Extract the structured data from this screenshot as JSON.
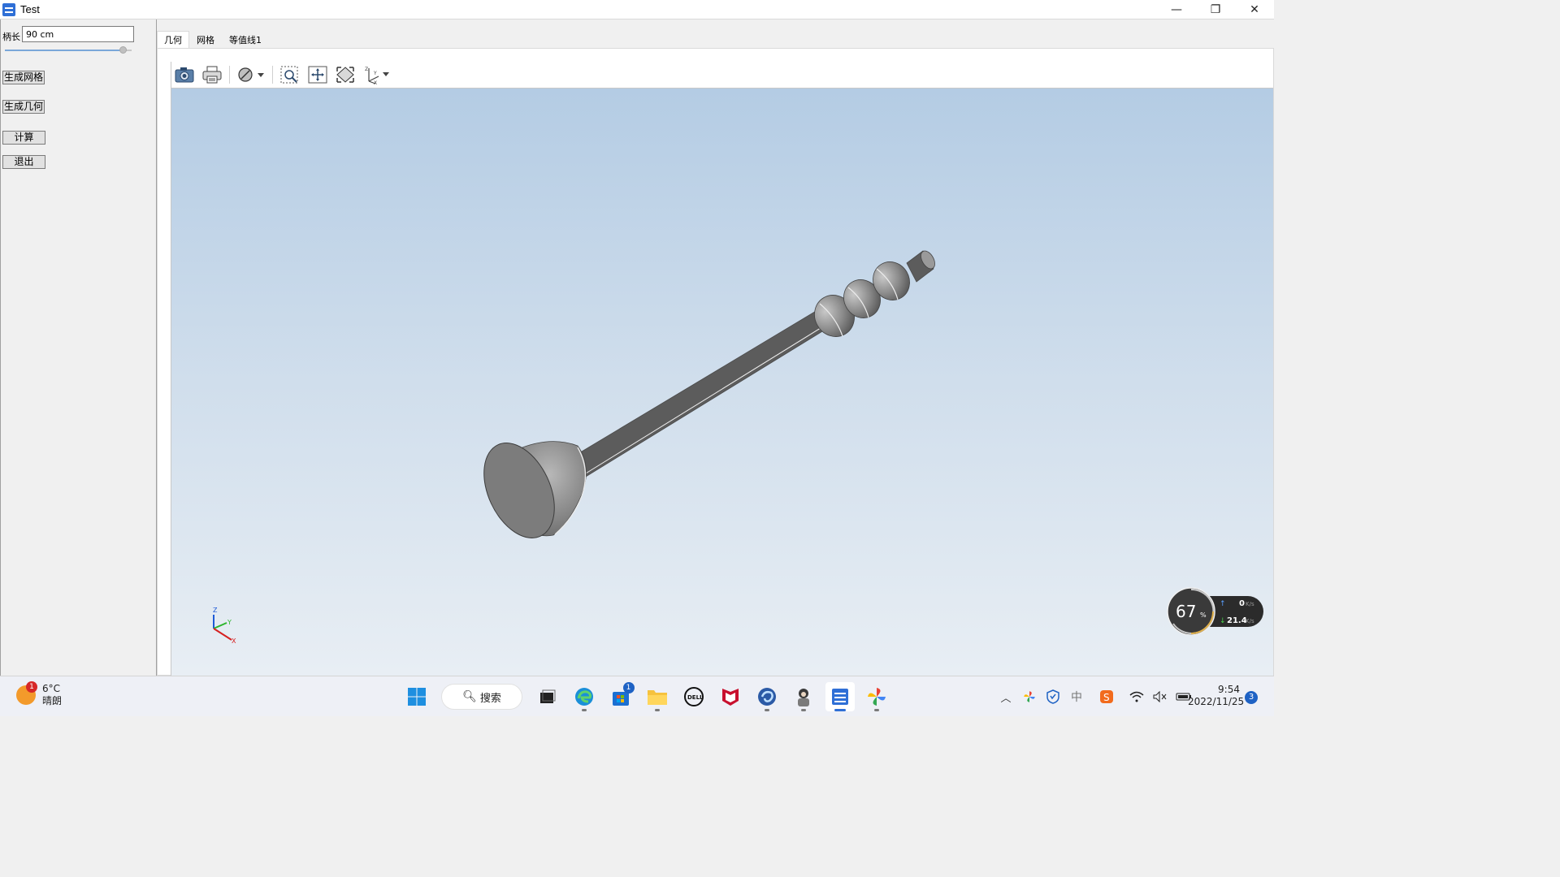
{
  "window": {
    "title": "Test",
    "minimize_glyph": "—",
    "maximize_glyph": "❐",
    "close_glyph": "✕"
  },
  "left_panel": {
    "length_label": "柄长",
    "length_value": "90 cm",
    "buttons": {
      "generate_mesh": "生成网格",
      "generate_geometry": "生成几何",
      "compute": "计算",
      "exit": "退出"
    }
  },
  "tabs": [
    {
      "label": "几何",
      "active": true
    },
    {
      "label": "网格",
      "active": false
    },
    {
      "label": "等值线1",
      "active": false
    }
  ],
  "toolbar": {
    "icons": [
      "camera-icon",
      "print-icon",
      "display-mode-icon",
      "zoom-box-icon",
      "pan-icon",
      "fit-view-icon",
      "axes-icon"
    ]
  },
  "render": {
    "axis_labels": {
      "z": "Z",
      "y": "Y",
      "x": "X"
    },
    "background_top": "#b4cce4",
    "background_bottom": "#e8eef4"
  },
  "net_widget": {
    "percent": "67",
    "percent_unit": "%",
    "upload": "0",
    "upload_unit": "K/s",
    "download": "21.4",
    "download_unit": "K/s"
  },
  "taskbar": {
    "weather_badge": "1",
    "temperature": "6°C",
    "condition": "晴朗",
    "search_label": "搜索",
    "store_badge": "1",
    "time": "9:54",
    "date": "2022/11/25",
    "notification_count": "3"
  },
  "colors": {
    "accent": "#2f6fd6",
    "model_gray": "#8c8c8c"
  }
}
